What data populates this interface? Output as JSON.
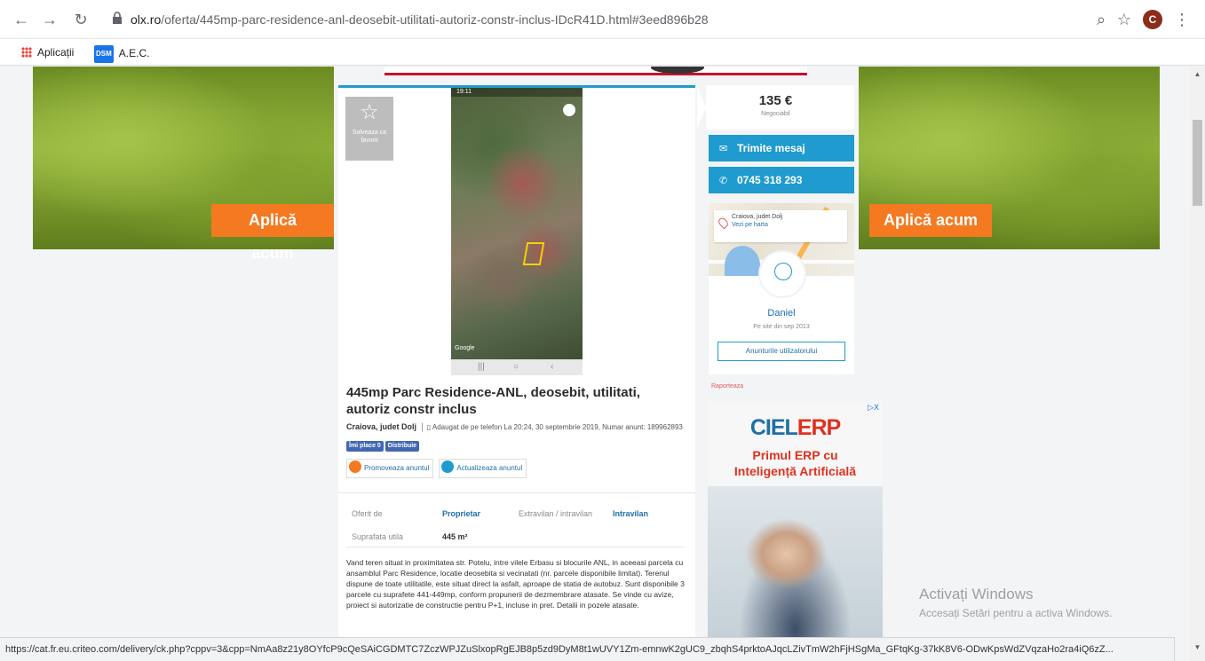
{
  "browser": {
    "url_host": "olx.ro",
    "url_path": "/oferta/445mp-parc-residence-anl-deosebit-utilitati-autoriz-constr-inclus-IDcR41D.html#3eed896b28",
    "profile_initial": "C",
    "bookmarks": [
      {
        "label": "Aplicații",
        "icon": "apps-grid-icon"
      },
      {
        "label": "A.E.C.",
        "icon": "dsm-icon",
        "badge": "DSM"
      }
    ]
  },
  "ads": {
    "apply_left": "Aplică acum",
    "apply_right": "Aplică acum"
  },
  "listing": {
    "favorite_label": "Salveaza ca favorit",
    "title": "445mp Parc Residence-ANL, deosebit, utilitati, autoriz constr inclus",
    "location": "Craiova, judet Dolj",
    "meta": "Adaugat de pe telefon  La 20:24, 30 septembrie 2019, Numar anunt: 189962893",
    "fb_like": "Îmi place 0",
    "fb_share": "Distribuie",
    "promote": "Promoveaza anuntul",
    "refresh": "Actualizeaza anuntul",
    "params": [
      {
        "label": "Oferit de",
        "value": "Proprietar"
      },
      {
        "label": "Extravilan / intravilan",
        "value": "Intravilan"
      },
      {
        "label": "Suprafata utila",
        "value": "445 m²"
      }
    ],
    "description": "Vand teren situat in proximitatea str. Potelu, intre vilele Erbasu si blocurile ANL, in aceeasi parcela cu ansamblul Parc Residence, locatie deosebita si vecinatati (nr. parcele disponibile limitat). Terenul dispune de toate utilitatile, este situat direct la asfalt, aproape de statia de autobuz. Sunt disponibile 3 parcele cu suprafete 441-449mp, conform propunerii de dezmembrare atasate. Se vinde cu avize, proiect si autorizatie de constructie pentru P+1, incluse in pret. Detalii in pozele atasate.",
    "map_label": "Google",
    "phone_status": "19:11"
  },
  "sidebar": {
    "price": "135 €",
    "negotiable": "Negociabil",
    "message_btn": "Trimite mesaj",
    "phone_btn": "0745 318 293",
    "loc_city": "Craiova, judet Dolj",
    "loc_link": "Vezi pe harta",
    "seller_name": "Daniel",
    "seller_since": "Pe site din sep 2013",
    "seller_ads": "Anunturile utilizatorului",
    "report": "Raporteaza"
  },
  "ad_ciel": {
    "brand1": "CIEL",
    "brand2": "ERP",
    "tagline_1": "Primul ERP cu",
    "tagline_2": "Inteligență Artificială",
    "adchoices": "▷X"
  },
  "watermark": {
    "line1": "Activați Windows",
    "line2": "Accesați Setări pentru a activa Windows."
  },
  "status_url": "https://cat.fr.eu.criteo.com/delivery/ck.php?cppv=3&cpp=NmAa8z21y8OYfcP9cQeSAiCGDMTC7ZczWPJZuSlxopRgEJB8p5zd9DyM8t1wUVY1Zm-emnwK2gUC9_zbqhS4prktoAJqcLZivTmW2hFjHSgMa_GFtqKg-37kK8V6-ODwKpsWdZVqzaHo2ra4iQ6zZ..."
}
